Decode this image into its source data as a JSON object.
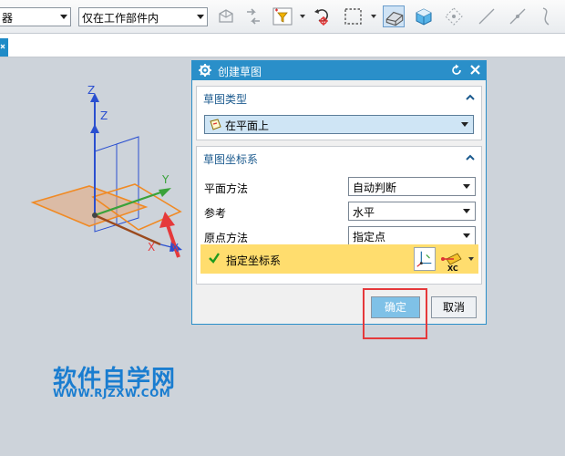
{
  "toolbar": {
    "filter_select": "器",
    "scope_select": "仅在工作部件内"
  },
  "dialog": {
    "title": "创建草图",
    "sketch_type_section": {
      "header": "草图类型",
      "selected": "在平面上"
    },
    "csys_section": {
      "header": "草图坐标系",
      "plane_method_label": "平面方法",
      "plane_method_value": "自动判断",
      "reference_label": "参考",
      "reference_value": "水平",
      "origin_method_label": "原点方法",
      "origin_method_value": "指定点",
      "specify_csys_label": "指定坐标系"
    },
    "ok_label": "确定",
    "cancel_label": "取消"
  },
  "viewport": {
    "axis_labels": {
      "z1": "Z",
      "z2": "Z",
      "y": "Y",
      "x1": "X",
      "x2": "X",
      "xc_badge": "XC"
    }
  },
  "watermark": {
    "main": "软件自学网",
    "url": "WWW.RJZXW.COM"
  },
  "colors": {
    "accent": "#2a8fc9",
    "section_header": "#1b5a8e",
    "highlight_row": "#ffdd6e",
    "annotation_red": "#e5393b",
    "plane_orange": "#f08a24",
    "watermark": "#1a7dd0"
  }
}
